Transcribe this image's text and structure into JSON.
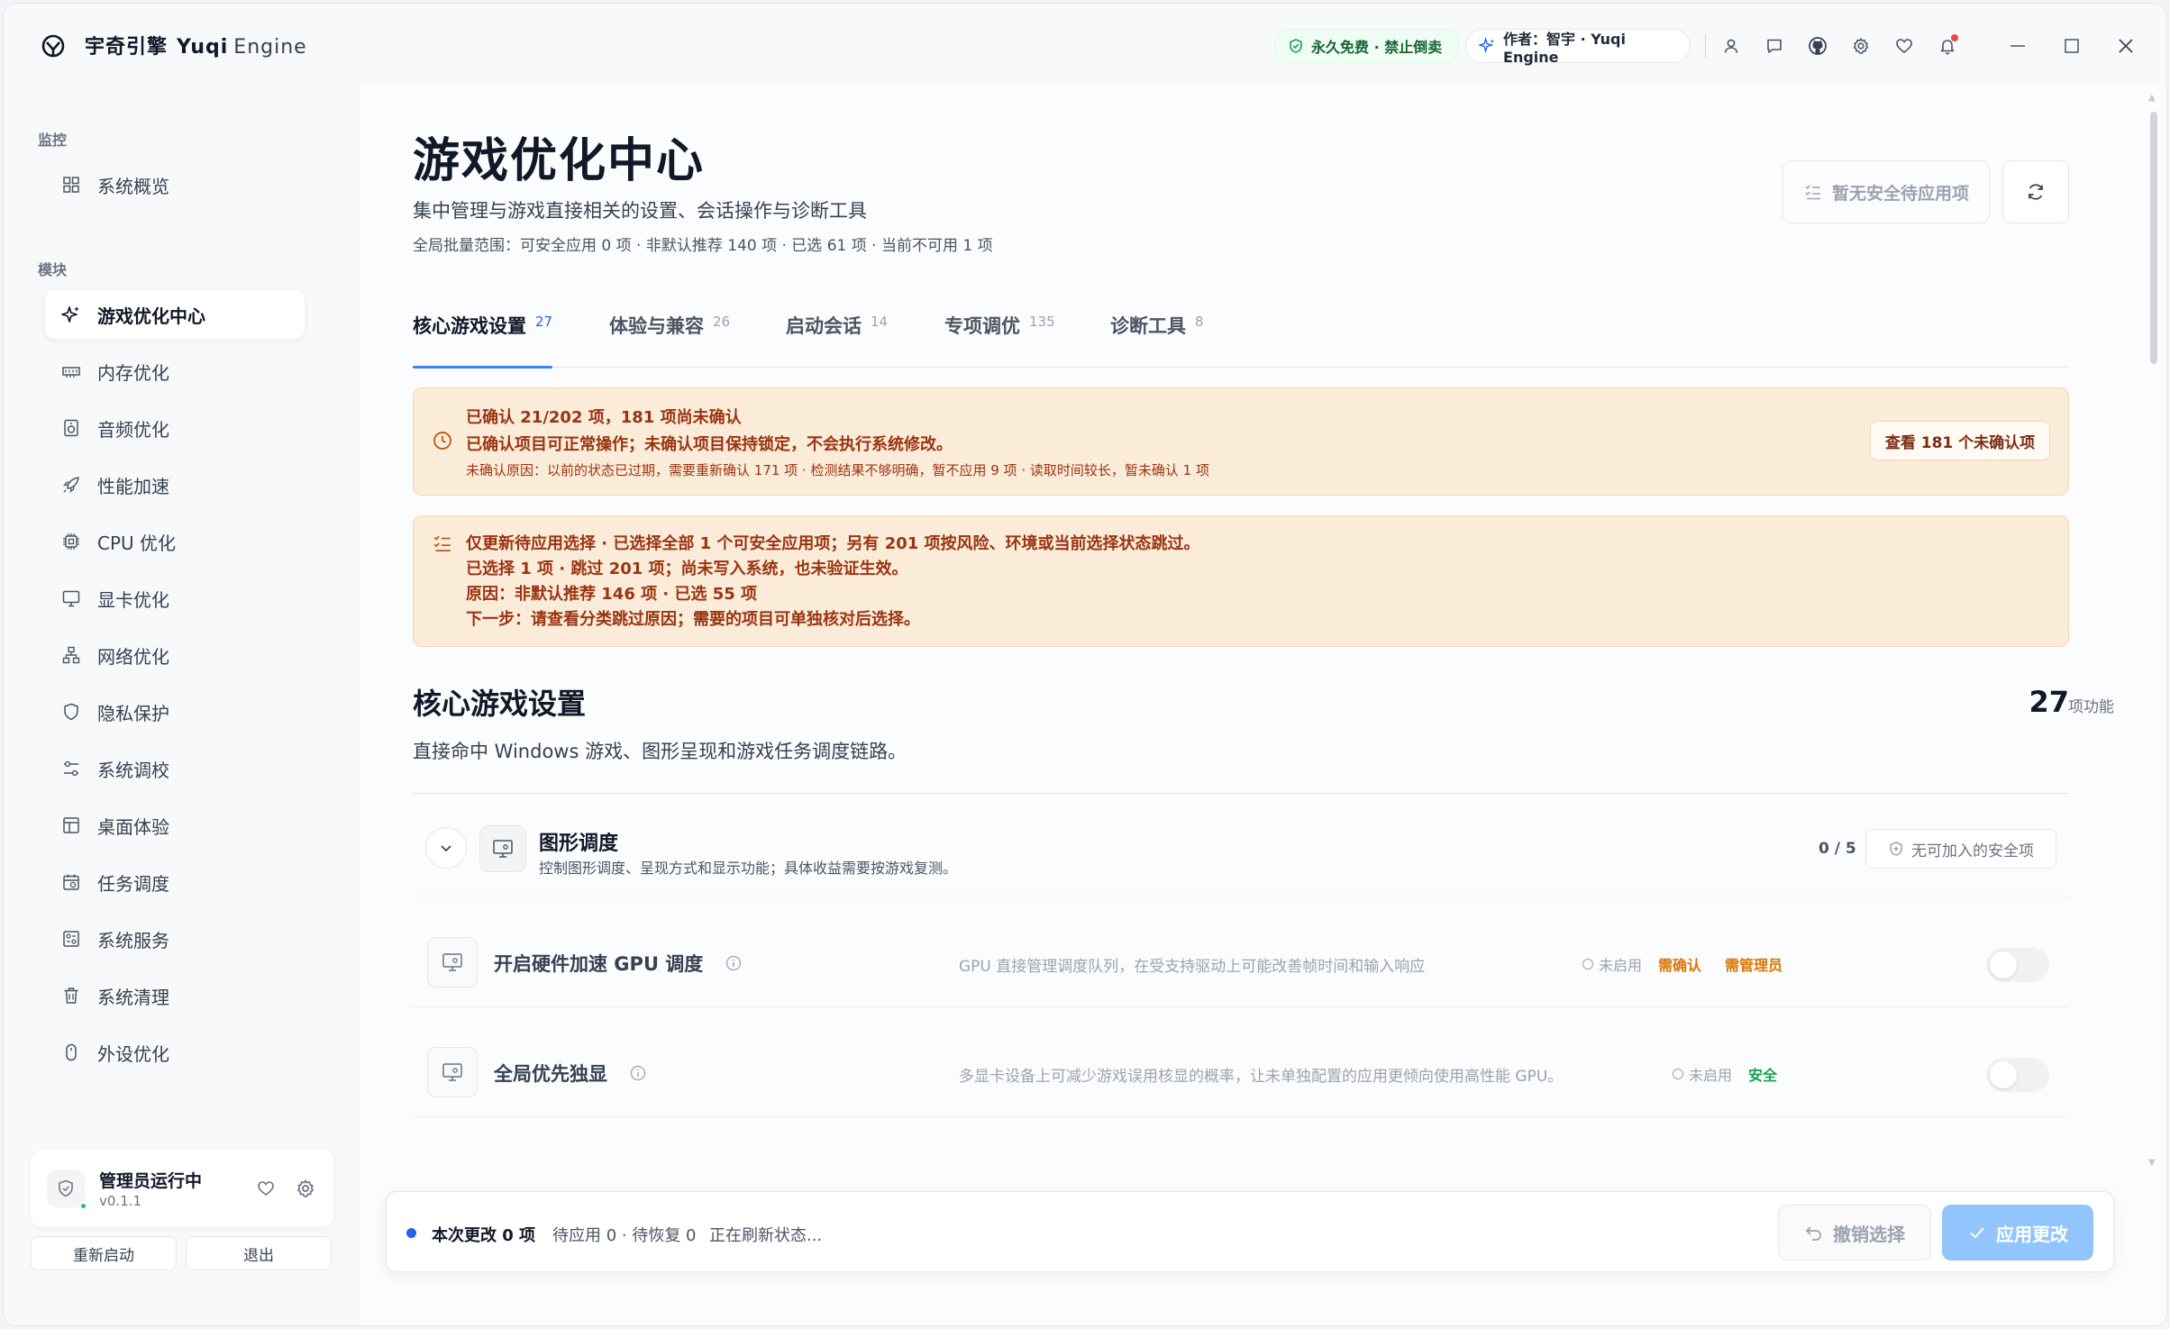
{
  "app": {
    "title_cn": "宇奇引擎",
    "title_en1": "Yuqi",
    "title_en2": "Engine",
    "badge_free": "永久免费 · 禁止倒卖",
    "badge_author": "作者：智宇 · Yuqi Engine"
  },
  "sidebar": {
    "section_monitor": "监控",
    "section_modules": "模块",
    "overview": "系统概览",
    "items": [
      {
        "label": "游戏优化中心",
        "icon": "sparkle-icon",
        "active": true
      },
      {
        "label": "内存优化",
        "icon": "memory-icon"
      },
      {
        "label": "音频优化",
        "icon": "speaker-icon"
      },
      {
        "label": "性能加速",
        "icon": "rocket-icon"
      },
      {
        "label": "CPU 优化",
        "icon": "cpu-icon"
      },
      {
        "label": "显卡优化",
        "icon": "monitor-icon"
      },
      {
        "label": "网络优化",
        "icon": "network-icon"
      },
      {
        "label": "隐私保护",
        "icon": "shield-icon"
      },
      {
        "label": "系统调校",
        "icon": "sliders-icon"
      },
      {
        "label": "桌面体验",
        "icon": "layout-icon"
      },
      {
        "label": "任务调度",
        "icon": "calendar-icon"
      },
      {
        "label": "系统服务",
        "icon": "service-icon"
      },
      {
        "label": "系统清理",
        "icon": "trash-icon"
      },
      {
        "label": "外设优化",
        "icon": "mouse-icon"
      }
    ],
    "status": {
      "title": "管理员运行中",
      "version": "v0.1.1",
      "restart": "重新启动",
      "exit": "退出"
    }
  },
  "header": {
    "title": "游戏优化中心",
    "subtitle": "集中管理与游戏直接相关的设置、会话操作与诊断工具",
    "scope": "全局批量范围：可安全应用 0 项 · 非默认推荐 140 项 · 已选 61 项 · 当前不可用 1 项",
    "pending_button": "暂无安全待应用项"
  },
  "tabs": [
    {
      "label": "核心游戏设置",
      "count": "27",
      "active": true
    },
    {
      "label": "体验与兼容",
      "count": "26"
    },
    {
      "label": "启动会话",
      "count": "14"
    },
    {
      "label": "专项调优",
      "count": "135"
    },
    {
      "label": "诊断工具",
      "count": "8"
    }
  ],
  "alert1": {
    "line1": "已确认 21/202 项，181 项尚未确认",
    "line2": "已确认项目可正常操作；未确认项目保持锁定，不会执行系统修改。",
    "line3": "未确认原因：以前的状态已过期，需要重新确认 171 项 · 检测结果不够明确，暂不应用 9 项 · 读取时间较长，暂未确认 1 项",
    "button": "查看 181 个未确认项"
  },
  "alert2": {
    "line1": "仅更新待应用选择 · 已选择全部 1 个可安全应用项；另有 201 项按风险、环境或当前选择状态跳过。",
    "line2": "已选择 1 项 · 跳过 201 项；尚未写入系统，也未验证生效。",
    "line3": "原因：非默认推荐 146 项 · 已选 55 项",
    "line4": "下一步：请查看分类跳过原因；需要的项目可单独核对后选择。"
  },
  "section": {
    "title": "核心游戏设置",
    "desc": "直接命中 Windows 游戏、图形呈现和游戏任务调度链路。",
    "count": "27",
    "count_label": "项功能"
  },
  "group": {
    "title": "图形调度",
    "desc": "控制图形调度、呈现方式和显示功能；具体收益需要按游戏复测。",
    "count": "0 / 5",
    "button": "无可加入的安全项"
  },
  "options": [
    {
      "name": "开启硬件加速 GPU 调度",
      "desc": "GPU 直接管理调度队列，在受支持驱动上可能改善帧时间和输入响应",
      "state": "未启用",
      "tag1": "需确认",
      "tag2": "需管理员"
    },
    {
      "name": "全局优先独显",
      "desc": "多显卡设备上可减少游戏误用核显的概率，让未单独配置的应用更倾向使用高性能 GPU。",
      "state": "未启用",
      "tag1": "安全"
    }
  ],
  "bottom": {
    "changes": "本次更改 0 项",
    "pending": "待应用 0 · 待恢复 0",
    "status": "正在刷新状态...",
    "undo": "撤销选择",
    "apply": "应用更改"
  },
  "colors": {
    "accent": "#3b82f6",
    "warning_bg": "#fbecd9",
    "warning_text": "#9a3412",
    "safe": "#16a34a",
    "confirm": "#d97706"
  }
}
